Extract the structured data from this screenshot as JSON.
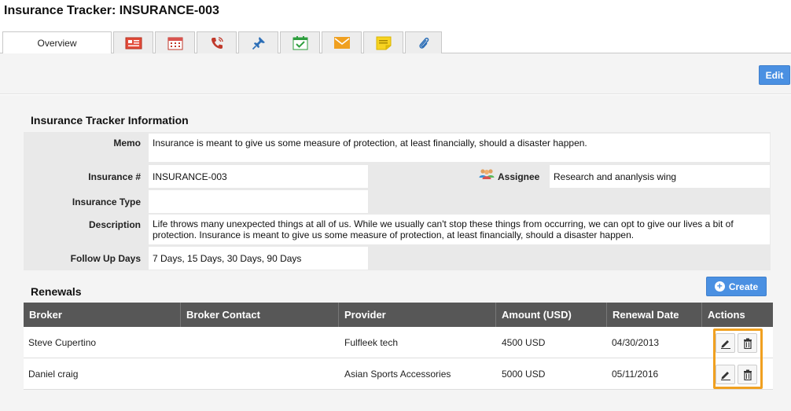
{
  "page": {
    "title": "Insurance Tracker: INSURANCE-003"
  },
  "tabs": [
    {
      "label": "Overview",
      "icon": null
    },
    {
      "label": "",
      "icon": "list-card-icon"
    },
    {
      "label": "",
      "icon": "calendar-icon"
    },
    {
      "label": "",
      "icon": "phone-icon"
    },
    {
      "label": "",
      "icon": "pin-icon"
    },
    {
      "label": "",
      "icon": "task-check-icon"
    },
    {
      "label": "",
      "icon": "email-icon"
    },
    {
      "label": "",
      "icon": "note-icon"
    },
    {
      "label": "",
      "icon": "attachment-icon"
    }
  ],
  "toolbar": {
    "edit_label": "Edit"
  },
  "info": {
    "section_title": "Insurance Tracker Information",
    "memo_label": "Memo",
    "memo_value": "Insurance is meant to give us some measure of protection, at least financially, should a disaster happen.",
    "insurance_no_label": "Insurance #",
    "insurance_no_value": "INSURANCE-003",
    "assignee_label": "Assignee",
    "assignee_value": "Research and ananlysis wing",
    "insurance_type_label": "Insurance Type",
    "insurance_type_value": "",
    "description_label": "Description",
    "description_value": "Life throws many unexpected things at all of us. While we usually can't stop these things from occurring, we can opt to give our lives a bit of protection. Insurance is meant to give us some measure of protection, at least financially, should a disaster happen.",
    "followup_label": "Follow Up Days",
    "followup_value": "7 Days, 15 Days, 30 Days, 90 Days"
  },
  "renewals": {
    "section_title": "Renewals",
    "create_label": "Create",
    "columns": [
      "Broker",
      "Broker Contact",
      "Provider",
      "Amount (USD)",
      "Renewal Date",
      "Actions"
    ],
    "rows": [
      {
        "broker": "Steve Cupertino",
        "contact": "",
        "provider": "Fulfleek tech",
        "amount": "4500 USD",
        "date": "04/30/2013"
      },
      {
        "broker": "Daniel craig",
        "contact": "",
        "provider": "Asian Sports Accessories",
        "amount": "5000 USD",
        "date": "05/11/2016"
      }
    ]
  },
  "colors": {
    "accent": "#4a90e2",
    "header_bg": "#575757",
    "highlight": "#f0a020"
  }
}
